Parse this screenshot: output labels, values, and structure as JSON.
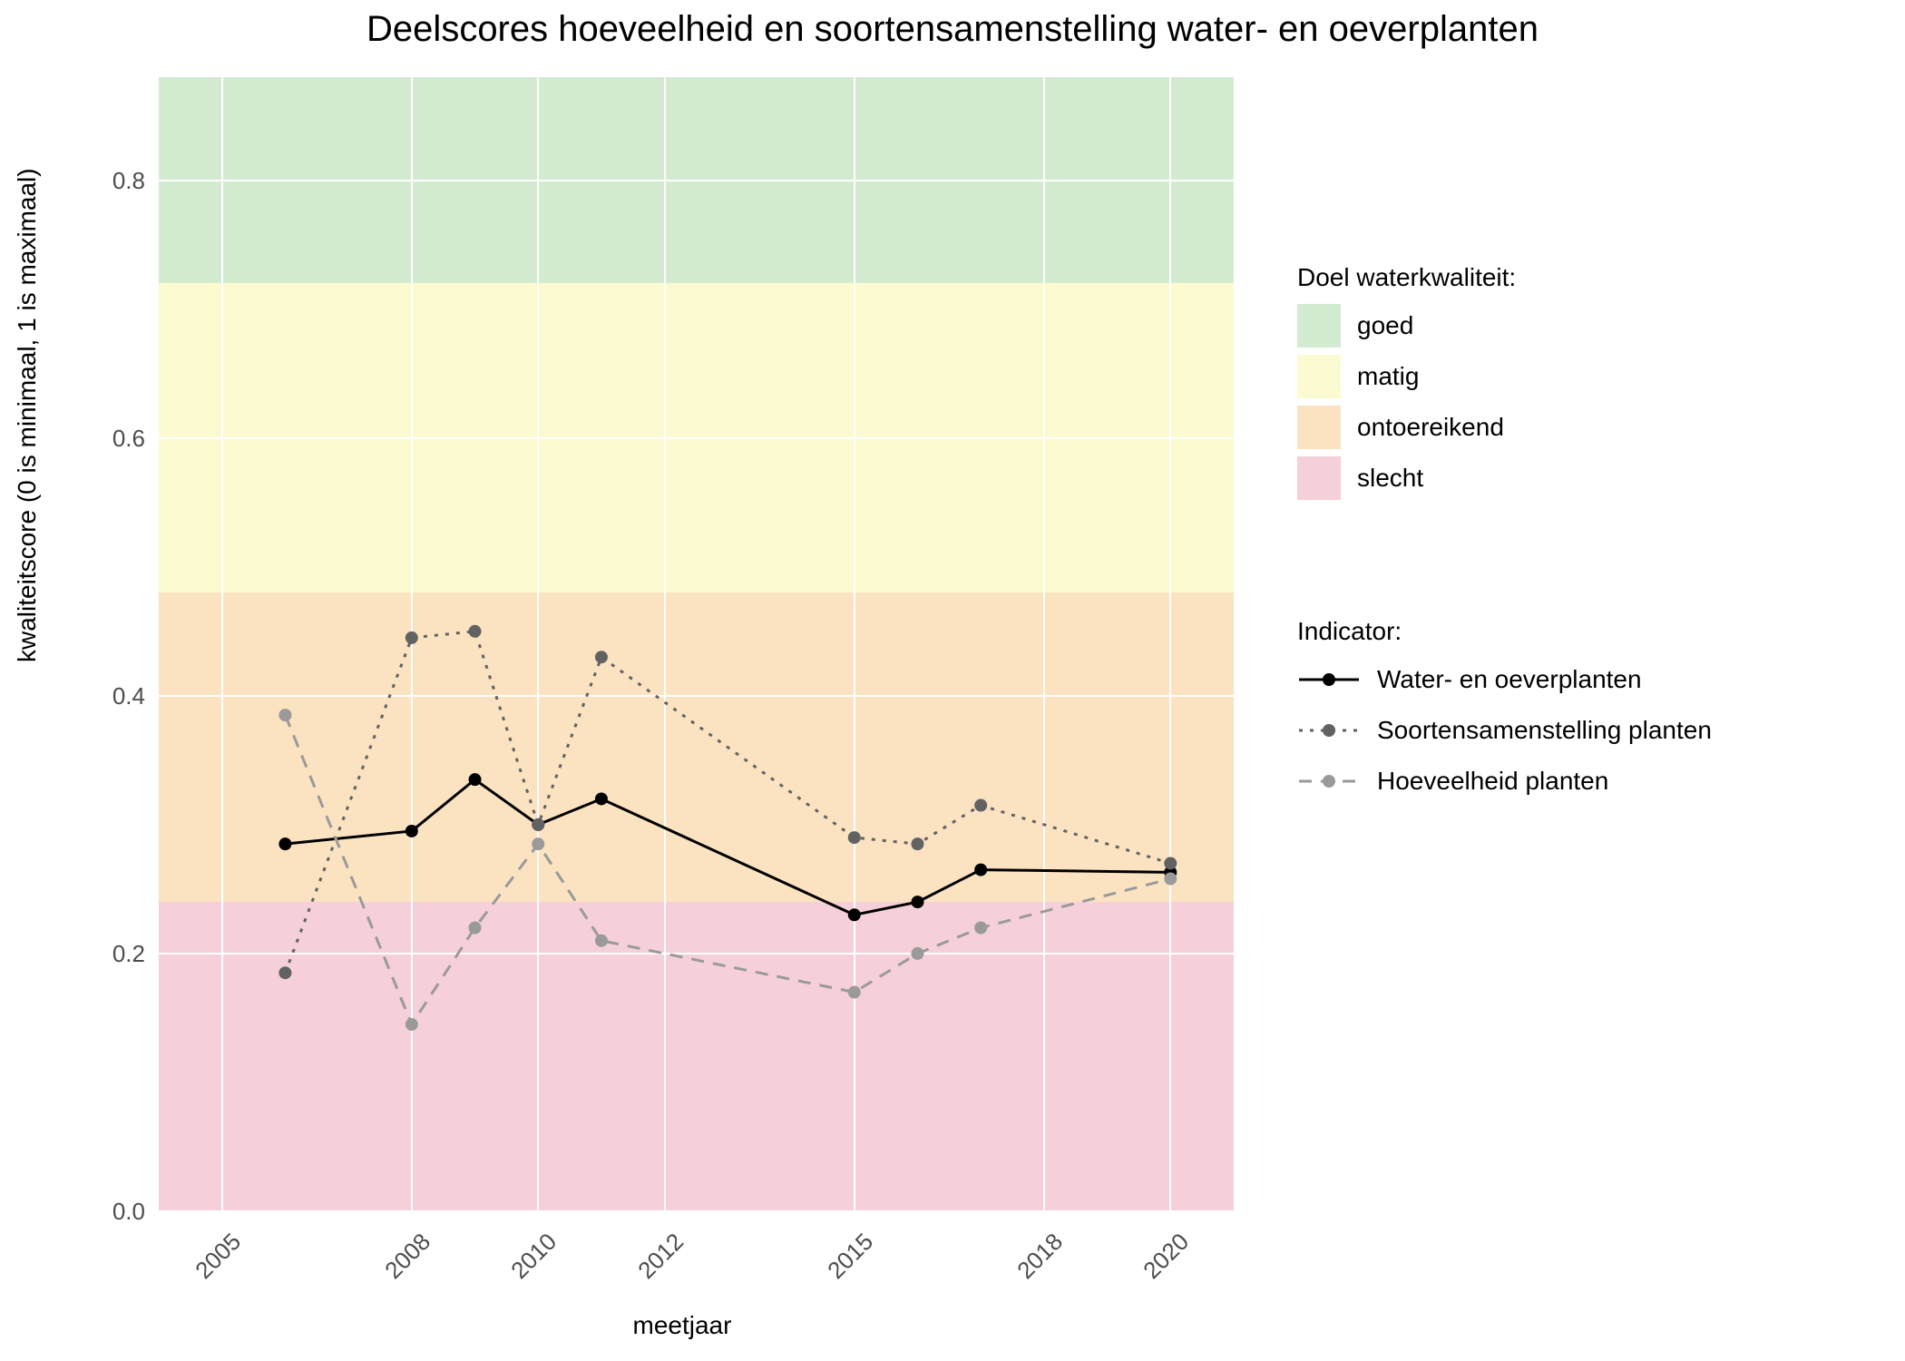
{
  "chart_data": {
    "type": "line",
    "title": "Deelscores hoeveelheid en soortensamenstelling water- en oeverplanten",
    "xlabel": "meetjaar",
    "ylabel": "kwaliteitscore (0 is minimaal, 1 is maximaal)",
    "xlim": [
      2004,
      2021
    ],
    "ylim": [
      0.0,
      0.88
    ],
    "xticks": [
      2005,
      2008,
      2010,
      2012,
      2015,
      2018,
      2020
    ],
    "yticks": [
      0.0,
      0.2,
      0.4,
      0.6,
      0.8
    ],
    "bands": [
      {
        "name": "goed",
        "from": 0.72,
        "to": 0.88,
        "color": "#d3ebd0"
      },
      {
        "name": "matig",
        "from": 0.48,
        "to": 0.72,
        "color": "#fcfad0"
      },
      {
        "name": "ontoereikend",
        "from": 0.24,
        "to": 0.48,
        "color": "#fbe3c2"
      },
      {
        "name": "slecht",
        "from": 0.0,
        "to": 0.24,
        "color": "#f6d0d9"
      }
    ],
    "series": [
      {
        "name": "Water- en oeverplanten",
        "color": "#000000",
        "linestyle": "solid",
        "x": [
          2006,
          2008,
          2009,
          2010,
          2011,
          2015,
          2016,
          2017,
          2020
        ],
        "values": [
          0.285,
          0.295,
          0.335,
          0.3,
          0.32,
          0.23,
          0.24,
          0.265,
          0.263
        ]
      },
      {
        "name": "Soortensamenstelling planten",
        "color": "#626262",
        "linestyle": "dotted",
        "x": [
          2006,
          2008,
          2009,
          2010,
          2011,
          2015,
          2016,
          2017,
          2020
        ],
        "values": [
          0.185,
          0.445,
          0.45,
          0.3,
          0.43,
          0.29,
          0.285,
          0.315,
          0.27
        ]
      },
      {
        "name": "Hoeveelheid planten",
        "color": "#9a9a9a",
        "linestyle": "dashed",
        "x": [
          2006,
          2008,
          2009,
          2010,
          2011,
          2015,
          2016,
          2017,
          2020
        ],
        "values": [
          0.385,
          0.145,
          0.22,
          0.285,
          0.21,
          0.17,
          0.2,
          0.22,
          0.258
        ]
      }
    ],
    "legend_titles": {
      "bands": "Doel waterkwaliteit:",
      "series": "Indicator:"
    }
  }
}
